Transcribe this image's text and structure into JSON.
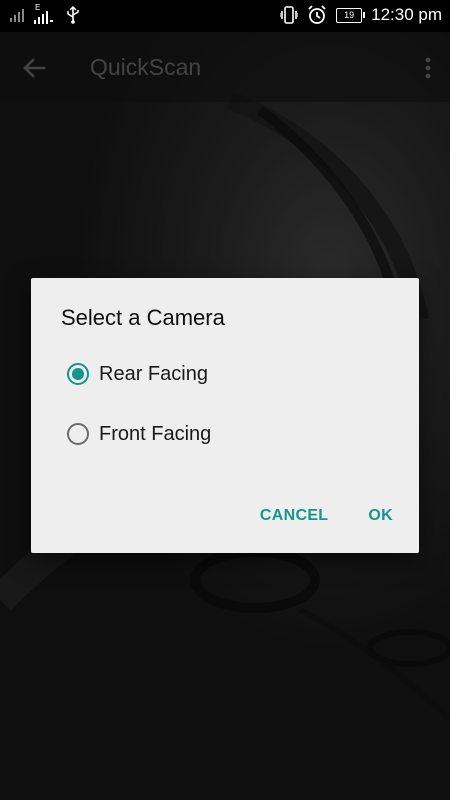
{
  "status_bar": {
    "network_label": "E",
    "battery_level": "19",
    "time": "12:30 pm"
  },
  "app_bar": {
    "title": "QuickScan",
    "back_icon": "arrow-back-icon",
    "overflow_icon": "more-vert-icon"
  },
  "dialog": {
    "title": "Select a Camera",
    "options": [
      {
        "label": "Rear Facing",
        "selected": true
      },
      {
        "label": "Front Facing",
        "selected": false
      }
    ],
    "cancel_label": "CANCEL",
    "ok_label": "OK"
  },
  "colors": {
    "accent": "#159688",
    "dialog_bg": "#eeeeee",
    "status_bar": "#000000"
  }
}
